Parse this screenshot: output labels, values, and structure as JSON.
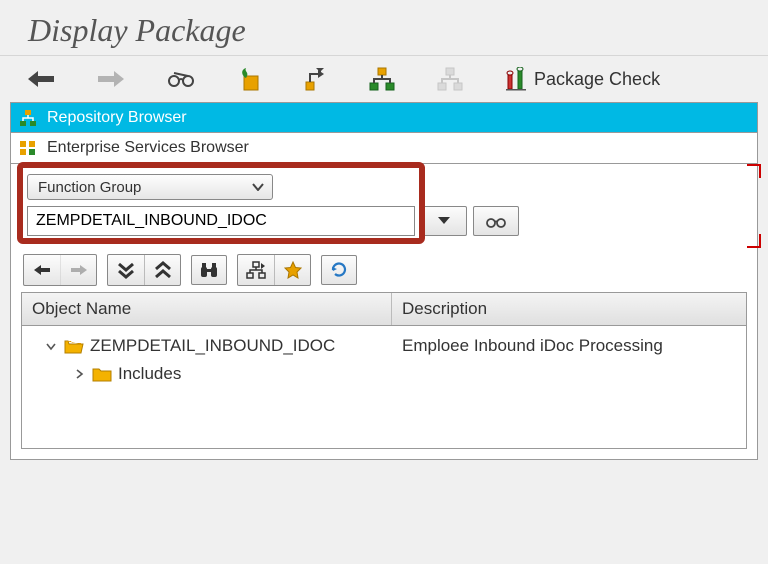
{
  "title": "Display Package",
  "toolbar": {
    "package_check": "Package Check"
  },
  "browsers": {
    "repository": "Repository Browser",
    "enterprise": "Enterprise Services Browser"
  },
  "selector": {
    "combo_label": "Function Group",
    "input_value": "ZEMPDETAIL_INBOUND_IDOC"
  },
  "table": {
    "headers": {
      "object": "Object Name",
      "description": "Description"
    },
    "root": {
      "name": "ZEMPDETAIL_INBOUND_IDOC",
      "desc": "Emploee Inbound iDoc Processing"
    },
    "child": {
      "name": "Includes"
    }
  }
}
